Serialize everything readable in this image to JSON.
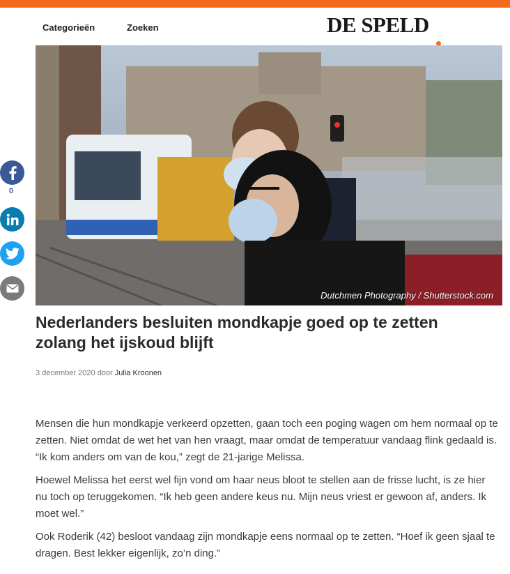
{
  "colors": {
    "accent": "#f26c1c",
    "facebook": "#3b5998",
    "linkedin": "#0a7cb0",
    "twitter": "#1da1f2",
    "mail": "#7a7a7a"
  },
  "nav": {
    "categories": "Categorieën",
    "search": "Zoeken"
  },
  "logo": {
    "text": "DE SPELD"
  },
  "hero": {
    "credit": "Dutchmen Photography / Shutterstock.com"
  },
  "share": {
    "facebook_count": "0",
    "icons": [
      "facebook-icon",
      "linkedin-icon",
      "twitter-icon",
      "mail-icon"
    ]
  },
  "article": {
    "title": "Nederlanders besluiten mondkapje goed op te zetten zolang het ijskoud blijft",
    "date": "3 december 2020",
    "by": "door",
    "author": "Julia Kroonen",
    "paragraphs": [
      "Mensen die hun mondkapje verkeerd opzetten, gaan toch een poging wagen om hem normaal op te zetten. Niet omdat de wet het van hen vraagt, maar omdat de temperatuur vandaag flink gedaald is. “Ik kom anders om van de kou,” zegt de 21-jarige Melissa.",
      "Hoewel Melissa het eerst wel fijn vond om haar neus bloot te stellen aan de frisse lucht, is ze hier nu toch op teruggekomen. “Ik heb geen andere keus nu. Mijn neus vriest er gewoon af, anders. Ik moet wel.”",
      "Ook Roderik (42) besloot vandaag zijn mondkapje eens normaal op te zetten. “Hoef ik geen sjaal te dragen. Best lekker eigenlijk, zo’n ding.”"
    ]
  }
}
